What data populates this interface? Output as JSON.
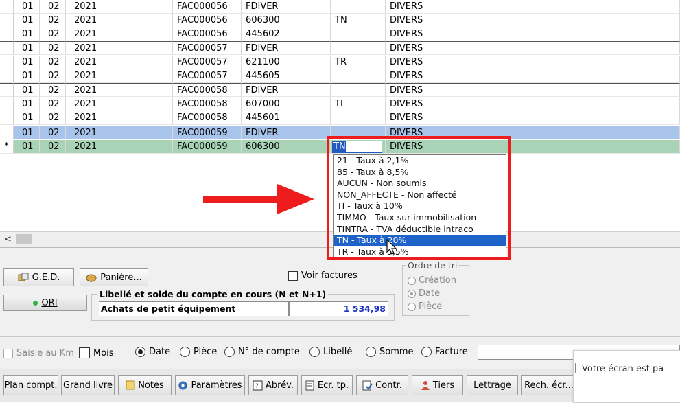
{
  "grid": {
    "rows": [
      {
        "marker": "",
        "j": "01",
        "m": "02",
        "y": "2021",
        "e": "FAC000056",
        "p": "FDIVER",
        "t": "",
        "l": "DIVERS"
      },
      {
        "marker": "",
        "j": "01",
        "m": "02",
        "y": "2021",
        "e": "FAC000056",
        "p": "606300",
        "t": "TN",
        "l": "DIVERS"
      },
      {
        "marker": "",
        "j": "01",
        "m": "02",
        "y": "2021",
        "e": "FAC000056",
        "p": "445602",
        "t": "",
        "l": "DIVERS"
      },
      {
        "marker": "",
        "j": "01",
        "m": "02",
        "y": "2021",
        "e": "FAC000057",
        "p": "FDIVER",
        "t": "",
        "l": "DIVERS"
      },
      {
        "marker": "",
        "j": "01",
        "m": "02",
        "y": "2021",
        "e": "FAC000057",
        "p": "621100",
        "t": "TR",
        "l": "DIVERS"
      },
      {
        "marker": "",
        "j": "01",
        "m": "02",
        "y": "2021",
        "e": "FAC000057",
        "p": "445605",
        "t": "",
        "l": "DIVERS"
      },
      {
        "marker": "",
        "j": "01",
        "m": "02",
        "y": "2021",
        "e": "FAC000058",
        "p": "FDIVER",
        "t": "",
        "l": "DIVERS"
      },
      {
        "marker": "",
        "j": "01",
        "m": "02",
        "y": "2021",
        "e": "FAC000058",
        "p": "607000",
        "t": "TI",
        "l": "DIVERS"
      },
      {
        "marker": "",
        "j": "01",
        "m": "02",
        "y": "2021",
        "e": "FAC000058",
        "p": "445601",
        "t": "",
        "l": "DIVERS"
      },
      {
        "marker": "",
        "j": "01",
        "m": "02",
        "y": "2021",
        "e": "FAC000059",
        "p": "FDIVER",
        "t": "",
        "l": "DIVERS"
      },
      {
        "marker": "*",
        "j": "01",
        "m": "02",
        "y": "2021",
        "e": "FAC000059",
        "p": "606300",
        "t": "TN",
        "l": "DIVERS"
      }
    ]
  },
  "dropdown": {
    "options": [
      "21 - Taux à 2,1%",
      "85 - Taux à 8,5%",
      "AUCUN - Non soumis",
      "NON_AFFECTE - Non affecté",
      "TI - Taux à 10%",
      "TIMMO - Taux sur immobilisation",
      "TINTRA - TVA déductible intraco",
      "TN - Taux à 20%",
      "TR - Taux à 5,5%"
    ],
    "selected_index": 7,
    "accent": "#1e63c8",
    "highlight_color": "#ee1c1c"
  },
  "panel": {
    "ged_label": "G.E.D.",
    "paniere_label": "Panière...",
    "voir_factures_label": "Voir factures",
    "ori_label": "ORI",
    "account_group_title": "Libellé et solde du compte en cours (N et N+1)",
    "account_name": "Achats de petit équipement",
    "account_balance": "1 534,98",
    "sort_group_title": "Ordre de tri",
    "sort_options": [
      "Création",
      "Date",
      "Pièce"
    ],
    "sort_selected": 1
  },
  "sortbar": {
    "saisie_km": "Saisie au Km",
    "mois": "Mois",
    "options": [
      "Date",
      "Pièce",
      "N° de compte",
      "Libellé",
      "Somme",
      "Facture"
    ],
    "selected": 0
  },
  "toolbar": {
    "buttons": [
      "Plan compt.",
      "Grand livre",
      "Notes",
      "Paramètres",
      "Abrév.",
      "Ecr. tp.",
      "Contr.",
      "Tiers",
      "Lettrage",
      "Rech. écr..."
    ]
  },
  "notification": {
    "text": "Votre écran est pa"
  }
}
